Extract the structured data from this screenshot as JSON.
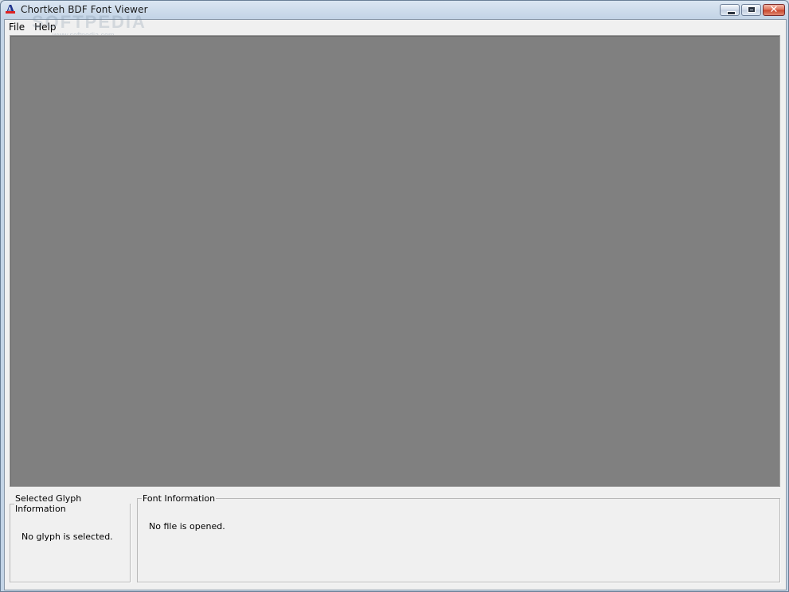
{
  "window": {
    "title": "Chortkeh BDF Font Viewer",
    "icon": "app-font-icon"
  },
  "caption_buttons": {
    "minimize": "minimize-icon",
    "maximize": "maximize-icon",
    "close_glyph": "✕"
  },
  "menubar": {
    "items": [
      {
        "label": "File"
      },
      {
        "label": "Help"
      }
    ]
  },
  "watermark": {
    "text": "SOFTPEDIA",
    "url": "www.softpedia.com"
  },
  "glyph_canvas": {
    "background": "#808080"
  },
  "panels": {
    "selected_glyph": {
      "legend": "Selected Glyph Information",
      "value": "No glyph is selected."
    },
    "font_info": {
      "legend": "Font Information",
      "value": "No file is opened."
    }
  }
}
